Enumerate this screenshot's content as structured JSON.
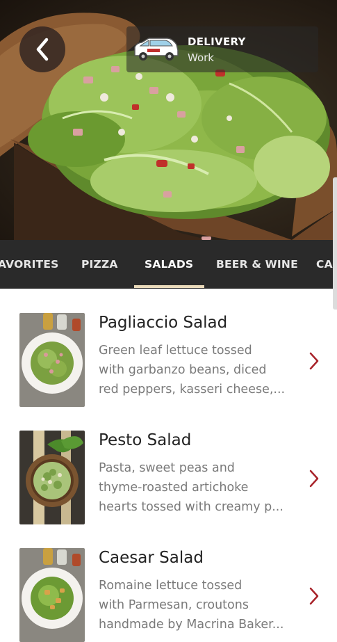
{
  "header": {
    "delivery_title": "DELIVERY",
    "delivery_location": "Work"
  },
  "tabs": [
    {
      "label": "AVORITES",
      "active": false
    },
    {
      "label": "PIZZA",
      "active": false
    },
    {
      "label": "SALADS",
      "active": true
    },
    {
      "label": "BEER & WINE",
      "active": false
    },
    {
      "label": "CA",
      "active": false
    }
  ],
  "items": [
    {
      "title": "Pagliaccio Salad",
      "desc": [
        "Green leaf lettuce tossed",
        "with garbanzo beans, diced",
        "red peppers, kasseri cheese,..."
      ]
    },
    {
      "title": "Pesto Salad",
      "desc": [
        "Pasta, sweet peas and",
        "thyme-roasted artichoke",
        "hearts tossed with creamy p..."
      ]
    },
    {
      "title": "Caesar Salad",
      "desc": [
        "Romaine lettuce tossed",
        "with Parmesan, croutons",
        "handmade by Macrina Baker..."
      ]
    }
  ],
  "colors": {
    "tab_bar": "#2a2a2a",
    "tab_indicator": "#e9d9b9",
    "chevron": "#a8232a",
    "title_text": "#222222",
    "desc_text": "#7a7a7a"
  },
  "icons": {
    "back": "chevron-left-icon",
    "delivery": "delivery-van-icon",
    "item_arrow": "chevron-right-icon"
  }
}
